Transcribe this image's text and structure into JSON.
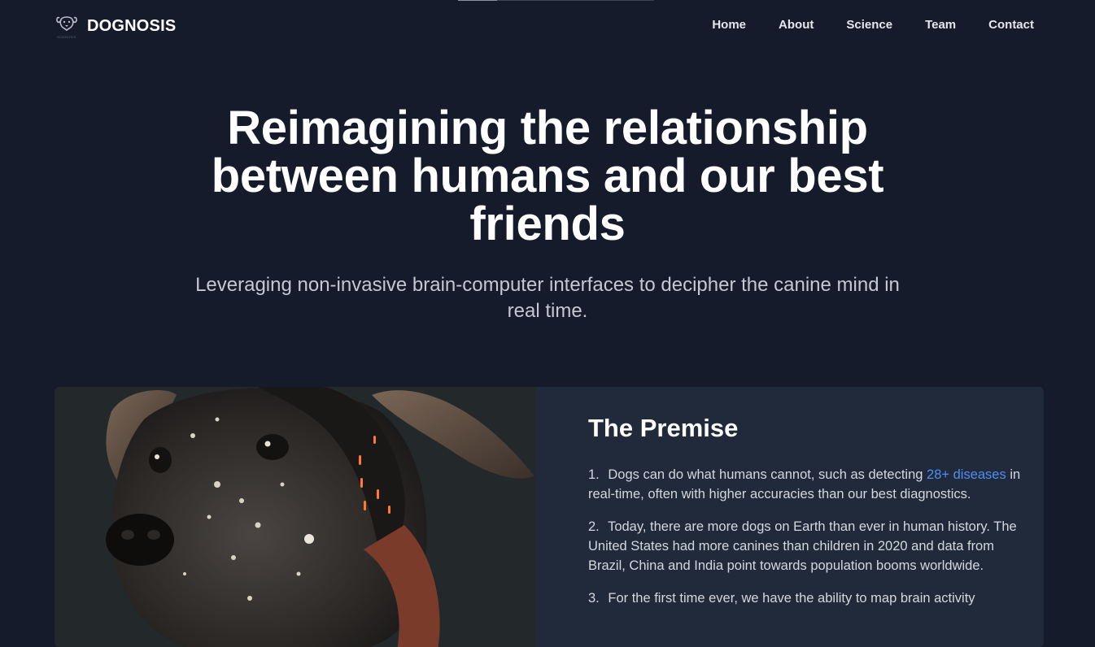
{
  "brand": {
    "name": "DOGNOSIS",
    "logo_small_text": "DOGNOSIS"
  },
  "nav": {
    "items": [
      {
        "label": "Home"
      },
      {
        "label": "About"
      },
      {
        "label": "Science"
      },
      {
        "label": "Team"
      },
      {
        "label": "Contact"
      }
    ]
  },
  "hero": {
    "title": "Reimagining the relationship between humans and our best friends",
    "subtitle": "Leveraging non-invasive brain-computer interfaces to decipher the canine mind in real time."
  },
  "premise": {
    "title": "The Premise",
    "items": [
      {
        "number": "1.",
        "text_before": "Dogs can do what humans cannot, such as detecting ",
        "link": "28+ diseases",
        "text_after": " in real-time, often with higher accuracies than our best diagnostics."
      },
      {
        "number": "2.",
        "text": "Today, there are more dogs on Earth than ever in human history. The United States had more canines than children in 2020 and data from Brazil, China and India point towards population booms worldwide."
      },
      {
        "number": "3.",
        "text": "For the first time ever, we have the ability to map brain activity"
      }
    ]
  },
  "colors": {
    "background": "#151b2b",
    "card": "#212a3b",
    "link": "#4f8ef0"
  },
  "icons": {
    "logo": "dog-head-logo-icon"
  }
}
